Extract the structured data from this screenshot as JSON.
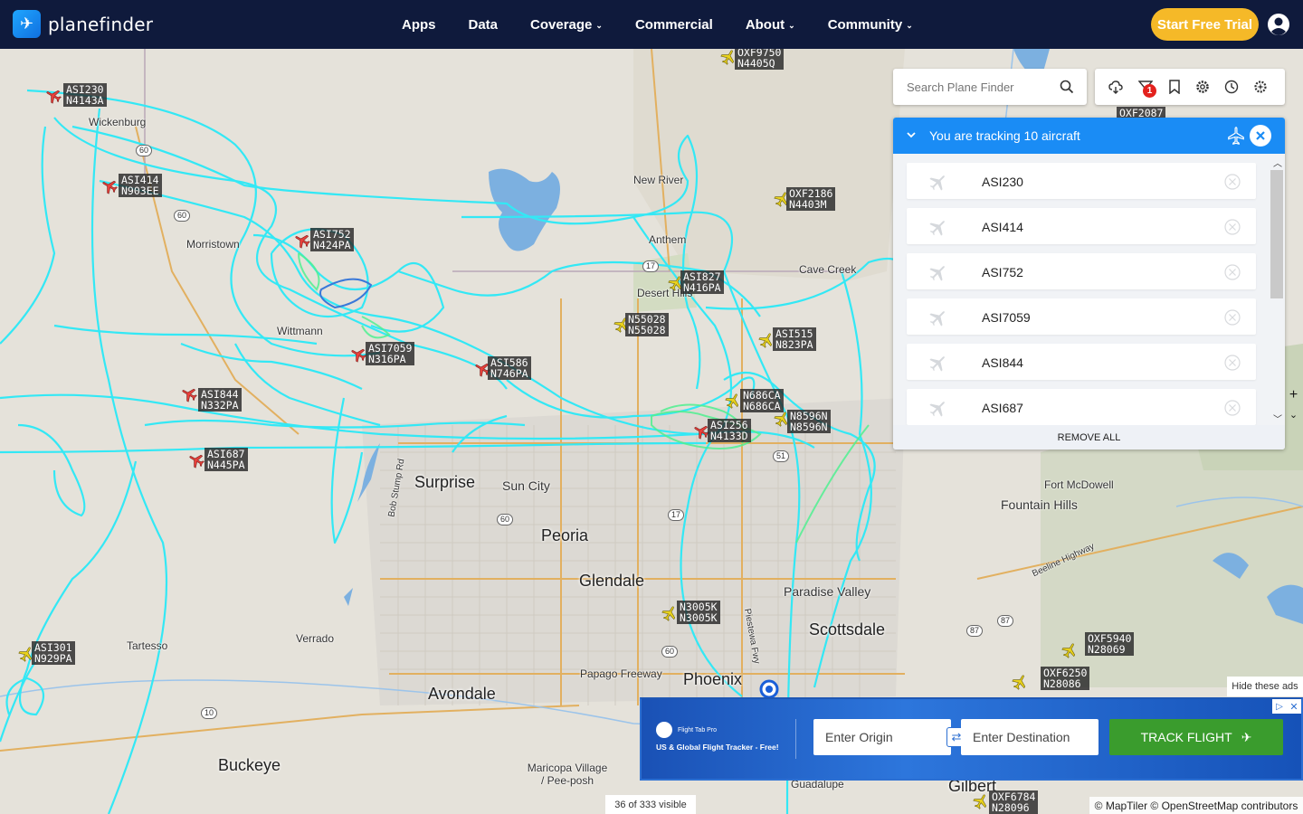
{
  "brand": {
    "name": "planefinder"
  },
  "nav": {
    "links": [
      {
        "label": "Apps",
        "has_menu": false
      },
      {
        "label": "Data",
        "has_menu": false
      },
      {
        "label": "Coverage",
        "has_menu": true
      },
      {
        "label": "Commercial",
        "has_menu": false
      },
      {
        "label": "About",
        "has_menu": true
      },
      {
        "label": "Community",
        "has_menu": true
      }
    ],
    "trial_button": "Start Free Trial"
  },
  "search": {
    "placeholder": "Search Plane Finder"
  },
  "toolbar": {
    "filter_badge": "1"
  },
  "tracking": {
    "title": "You are tracking 10 aircraft",
    "items": [
      "ASI230",
      "ASI414",
      "ASI752",
      "ASI7059",
      "ASI844",
      "ASI687"
    ],
    "remove_all": "REMOVE ALL"
  },
  "map": {
    "towns": [
      "Wickenburg",
      "Morristown",
      "Wittmann",
      "New River",
      "Anthem",
      "Desert Hills",
      "Cave Creek",
      "Sun City",
      "Fort McDowell",
      "Fountain Hills",
      "Paradise Valley",
      "Tartesso",
      "Verrado",
      "Papago Freeway",
      "Maricopa Village / Pee-posh",
      "Guadalupe",
      "Piestewa Fwy",
      "Beeline Highway",
      "Bob Stump Rd",
      "Gilbert"
    ],
    "cities": [
      "Surprise",
      "Peoria",
      "Glendale",
      "Phoenix",
      "Scottsdale",
      "Avondale",
      "Buckeye"
    ],
    "route_shields": [
      "60",
      "60",
      "60",
      "60",
      "17",
      "17",
      "51",
      "87",
      "87",
      "10"
    ],
    "aircraft": [
      {
        "callsign": "ASI230",
        "reg": "N4143A",
        "color": "red"
      },
      {
        "callsign": "ASI414",
        "reg": "N903EE",
        "color": "red"
      },
      {
        "callsign": "ASI752",
        "reg": "N424PA",
        "color": "red"
      },
      {
        "callsign": "ASI7059",
        "reg": "N316PA",
        "color": "red"
      },
      {
        "callsign": "ASI844",
        "reg": "N332PA",
        "color": "red"
      },
      {
        "callsign": "ASI687",
        "reg": "N445PA",
        "color": "red"
      },
      {
        "callsign": "ASI586",
        "reg": "N746PA",
        "color": "red"
      },
      {
        "callsign": "ASI256",
        "reg": "N4133D",
        "color": "red"
      },
      {
        "callsign": "ASI301",
        "reg": "N929PA",
        "color": "yellow"
      },
      {
        "callsign": "OXF9750",
        "reg": "N4405Q",
        "color": "yellow"
      },
      {
        "callsign": "OXF2186",
        "reg": "N4403M",
        "color": "yellow"
      },
      {
        "callsign": "OXF2087",
        "reg": "",
        "color": "yellow"
      },
      {
        "callsign": "ASI827",
        "reg": "N416PA",
        "color": "yellow"
      },
      {
        "callsign": "N55028",
        "reg": "N55028",
        "color": "yellow"
      },
      {
        "callsign": "ASI515",
        "reg": "N823PA",
        "color": "yellow"
      },
      {
        "callsign": "N686CA",
        "reg": "N686CA",
        "color": "yellow"
      },
      {
        "callsign": "N8596N",
        "reg": "N8596N",
        "color": "yellow"
      },
      {
        "callsign": "N3005K",
        "reg": "N3005K",
        "color": "yellow"
      },
      {
        "callsign": "OXF5940",
        "reg": "N28069",
        "color": "yellow"
      },
      {
        "callsign": "OXF6250",
        "reg": "N28086",
        "color": "yellow"
      },
      {
        "callsign": "OXF6784",
        "reg": "N28096",
        "color": "yellow"
      }
    ],
    "track_color": "#33e8f5"
  },
  "ad": {
    "brand": "Flight Tab Pro",
    "tagline": "US & Global Flight Tracker - Free!",
    "origin_placeholder": "Enter Origin",
    "destination_placeholder": "Enter Destination",
    "button": "TRACK FLIGHT",
    "hide": "Hide these ads"
  },
  "footer": {
    "visible_count": "36 of 333 visible",
    "attribution": "© MapTiler © OpenStreetMap contributors"
  }
}
